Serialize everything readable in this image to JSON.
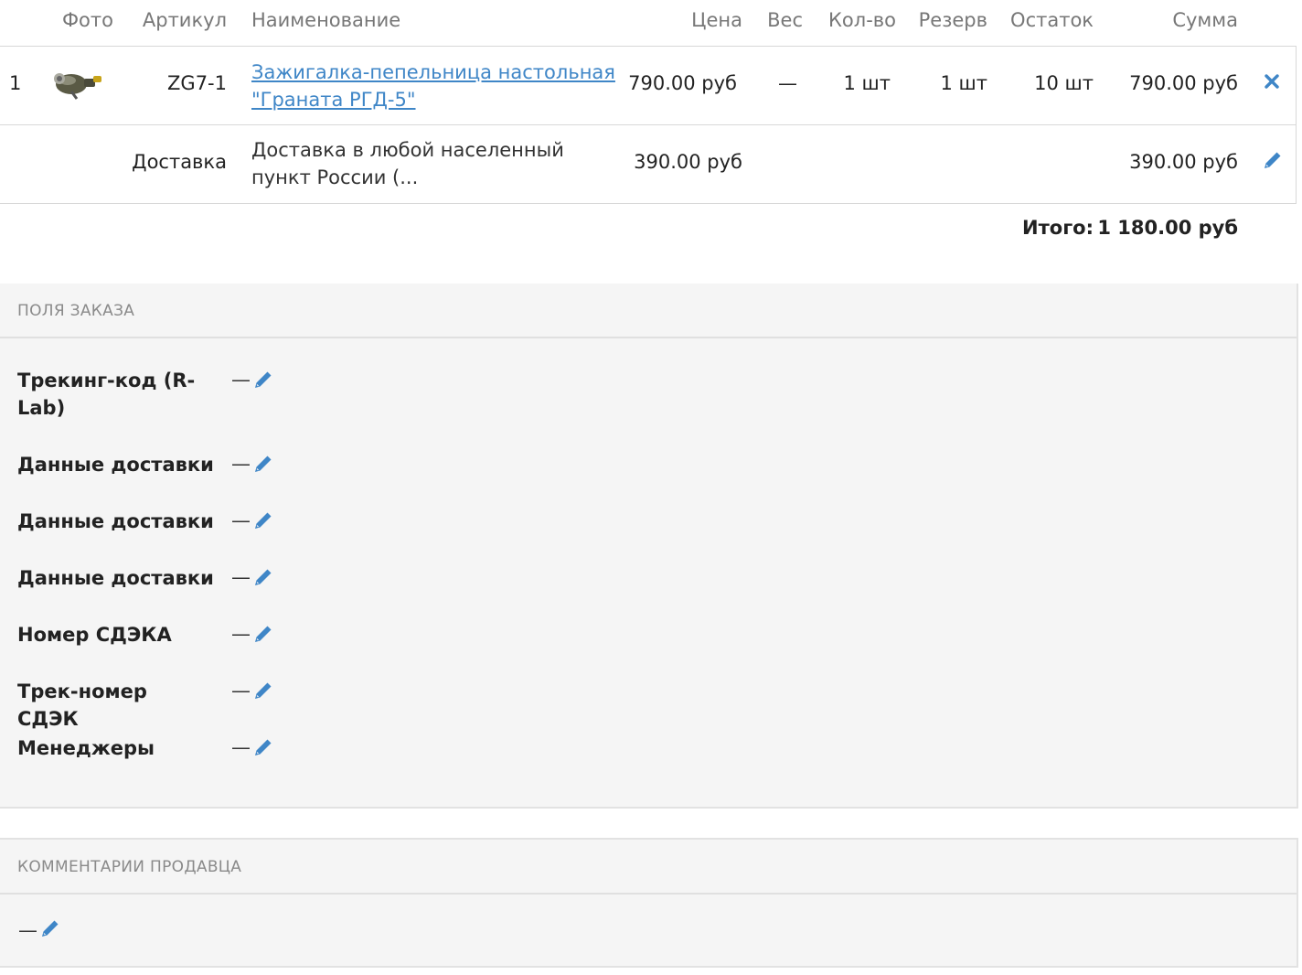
{
  "table": {
    "headers": {
      "photo": "Фото",
      "sku": "Артикул",
      "name": "Наименование",
      "price": "Цена",
      "weight": "Вес",
      "qty": "Кол-во",
      "reserve": "Резерв",
      "stock": "Остаток",
      "sum": "Сумма"
    },
    "item": {
      "index": "1",
      "sku": "ZG7-1",
      "name_line1": "Зажигалка-пепельница настольная",
      "name_line2": "\"Граната РГД-5\"",
      "price": "790.00 руб",
      "weight": "—",
      "qty": "1 шт",
      "reserve": "1 шт",
      "stock": "10 шт",
      "sum": "790.00 руб",
      "remove_icon": "close-icon"
    },
    "delivery": {
      "label": "Доставка",
      "name_line1": "Доставка в любой населенный",
      "name_line2": "пункт России (...",
      "price": "390.00 руб",
      "sum": "390.00 руб",
      "edit_icon": "pencil-icon"
    },
    "total": {
      "label": "Итого:",
      "value": "1 180.00 руб"
    }
  },
  "order_fields": {
    "title": "ПОЛЯ ЗАКАЗА",
    "fields": [
      {
        "label_line1": "Трекинг-код (R-",
        "label_line2": "Lab)",
        "value": "—"
      },
      {
        "label_line1": "Данные доставки",
        "label_line2": "",
        "value": "—"
      },
      {
        "label_line1": "Данные доставки",
        "label_line2": "",
        "value": "—"
      },
      {
        "label_line1": "Данные доставки",
        "label_line2": "",
        "value": "—"
      },
      {
        "label_line1": "Номер СДЭКА",
        "label_line2": "",
        "value": "—"
      },
      {
        "label_line1": "Трек-номер СДЭК",
        "label_line2": "",
        "value": "—"
      },
      {
        "label_line1": "Менеджеры",
        "label_line2": "",
        "value": "—"
      }
    ]
  },
  "seller_comments": {
    "title": "КОММЕНТАРИИ ПРОДАВЦА",
    "value": "—"
  },
  "colors": {
    "link": "#3f86c7",
    "icon": "#3f86c7",
    "panel_bg": "#f5f5f5",
    "border": "#d8d8d8"
  }
}
